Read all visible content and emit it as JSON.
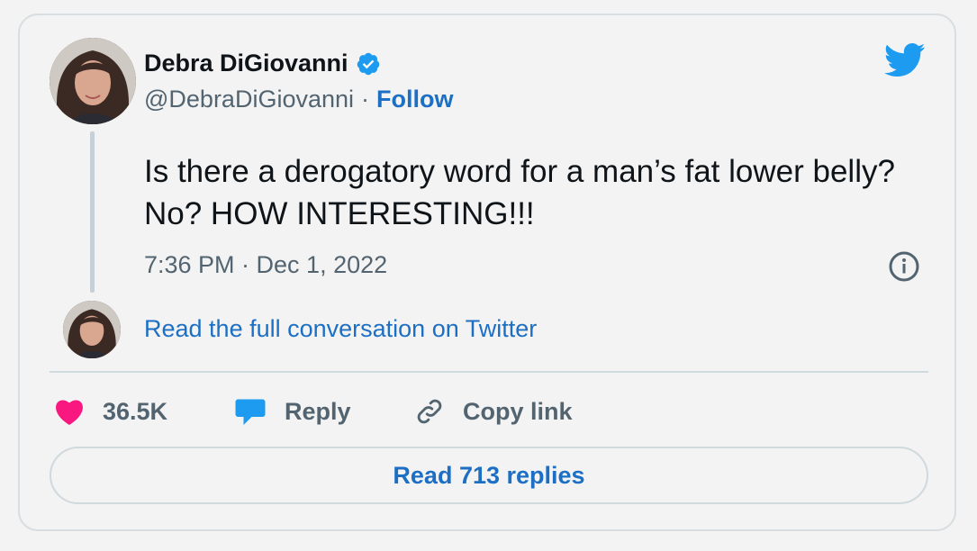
{
  "author": {
    "name": "Debra DiGiovanni",
    "handle": "@DebraDiGiovanni",
    "separator": "·",
    "follow_label": "Follow"
  },
  "tweet": {
    "text": "Is there a derogatory word for a man’s fat lower belly? No? HOW INTERESTING!!!",
    "timestamp": "7:36 PM · Dec 1, 2022"
  },
  "conversation_link": "Read the full conversation on Twitter",
  "actions": {
    "likes": "36.5K",
    "reply_label": "Reply",
    "copy_link_label": "Copy link"
  },
  "read_replies_label": "Read 713 replies",
  "colors": {
    "accent": "#1d6fc4",
    "twitter_blue": "#1d9bf0",
    "like_pink": "#f91880",
    "verified_blue": "#1d9bf0"
  },
  "icons": [
    "verified-badge-icon",
    "twitter-bird-icon",
    "info-icon",
    "heart-icon",
    "reply-bubble-icon",
    "link-icon"
  ]
}
